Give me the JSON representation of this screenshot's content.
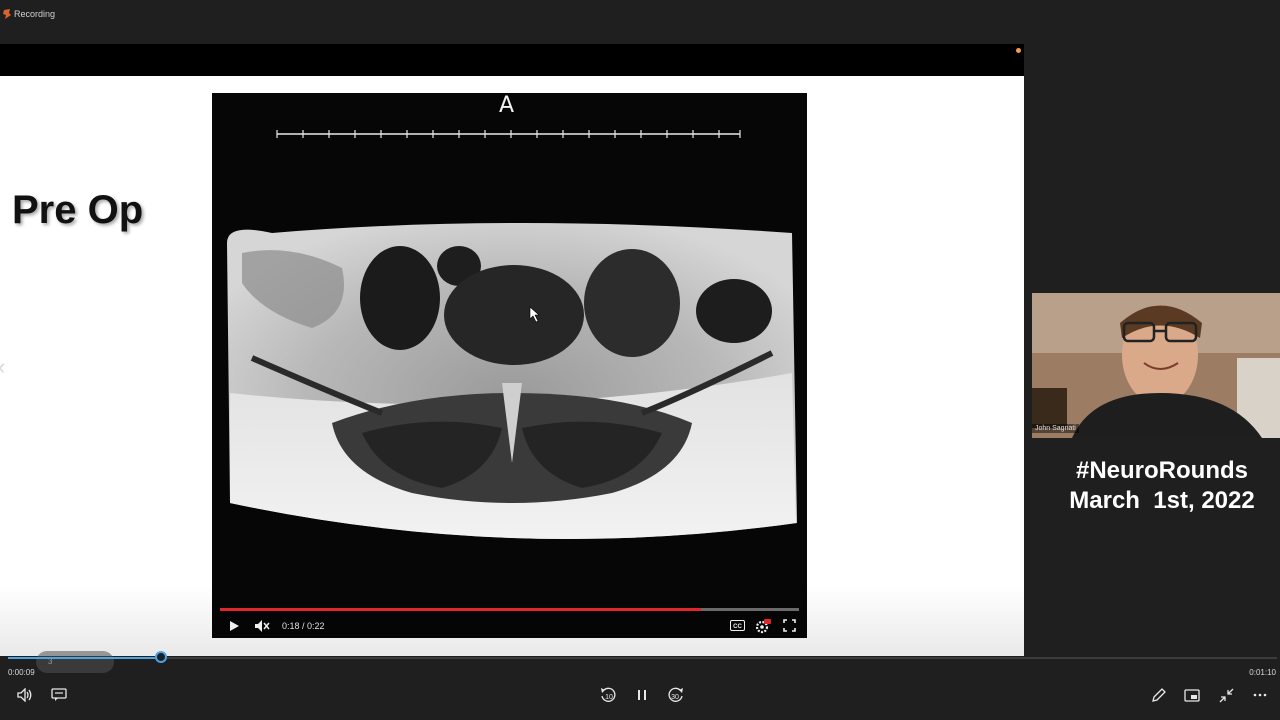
{
  "topbar": {
    "title": "Recording"
  },
  "slide": {
    "title": "Pre Op",
    "prev_icon": "chevron-left-icon"
  },
  "video": {
    "image_letter": "A",
    "time_display": "0:18 / 0:22",
    "progress": 0.83,
    "icons": [
      "play-icon",
      "mute-icon",
      "cc-icon",
      "settings-icon",
      "fullscreen-icon"
    ]
  },
  "webcam": {
    "name_label": "John Sagnati"
  },
  "overlay": {
    "line1": "#NeuroRounds",
    "line2": "March  1st, 2022"
  },
  "player": {
    "current_time": "0:00:09",
    "total_time": "0:01:10",
    "chapter_number": "3",
    "accent_color": "#4aa3e6",
    "icons": [
      "volume-icon",
      "captions-icon",
      "rewind-10-icon",
      "pause-icon",
      "forward-30-icon",
      "pen-icon",
      "picture-in-picture-icon",
      "collapse-icon",
      "more-icon"
    ]
  }
}
